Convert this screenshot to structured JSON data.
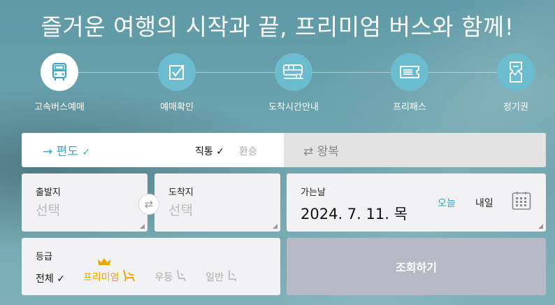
{
  "headline": "즐거운 여행의 시작과 끝, 프리미엄 버스와 함께!",
  "steps": [
    {
      "label": "고속버스예매",
      "icon": "bus-icon",
      "active": true
    },
    {
      "label": "예매확인",
      "icon": "checkbox-icon",
      "active": false
    },
    {
      "label": "도착시간안내",
      "icon": "bus-arrival-icon",
      "active": false
    },
    {
      "label": "프리패스",
      "icon": "ticket-icon",
      "active": false
    },
    {
      "label": "정기권",
      "icon": "pass-icon",
      "active": false
    }
  ],
  "trip": {
    "oneway_arrow": "→",
    "oneway_label": "편도",
    "check": "✓",
    "direct_label": "직통",
    "transfer_label": "환승",
    "round_arrow": "⇄",
    "round_label": "왕복"
  },
  "departure": {
    "caption": "출발지",
    "value": "선택"
  },
  "arrival": {
    "caption": "도착지",
    "value": "선택"
  },
  "date": {
    "caption": "가는날",
    "value": "2024. 7. 11. 목",
    "today": "오늘",
    "tomorrow": "내일"
  },
  "grade": {
    "caption": "등급",
    "all": "전체",
    "premium": "프리미엄",
    "standard": "우등",
    "general": "일반"
  },
  "search_button": "조회하기",
  "colors": {
    "accent": "#3aa6c4",
    "premium": "#f0a400",
    "button": "#b7b9c6",
    "step_circle": "#6cbcd0"
  }
}
